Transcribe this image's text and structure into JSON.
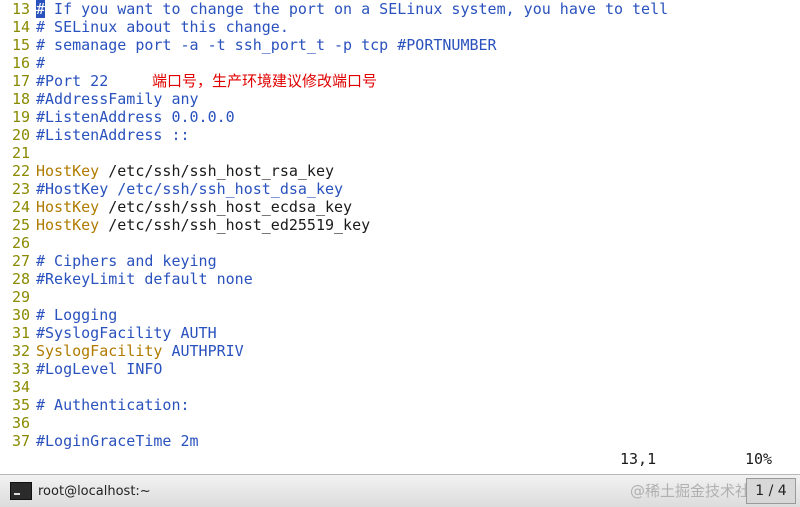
{
  "editor": {
    "lines": [
      {
        "n": "13",
        "tokens": [
          {
            "t": "#",
            "c": "cursor"
          },
          {
            "t": " If you want to change the port on a SELinux system, you have to tell",
            "c": "comment"
          }
        ]
      },
      {
        "n": "14",
        "tokens": [
          {
            "t": "# SELinux about this change.",
            "c": "comment"
          }
        ]
      },
      {
        "n": "15",
        "tokens": [
          {
            "t": "# semanage port -a -t ssh_port_t -p tcp #PORTNUMBER",
            "c": "comment"
          }
        ]
      },
      {
        "n": "16",
        "tokens": [
          {
            "t": "#",
            "c": "comment"
          }
        ]
      },
      {
        "n": "17",
        "tokens": [
          {
            "t": "#Port 22",
            "c": "comment"
          }
        ]
      },
      {
        "n": "18",
        "tokens": [
          {
            "t": "#AddressFamily any",
            "c": "comment"
          }
        ]
      },
      {
        "n": "19",
        "tokens": [
          {
            "t": "#ListenAddress 0.0.0.0",
            "c": "comment"
          }
        ]
      },
      {
        "n": "20",
        "tokens": [
          {
            "t": "#ListenAddress ::",
            "c": "comment"
          }
        ]
      },
      {
        "n": "21",
        "tokens": []
      },
      {
        "n": "22",
        "tokens": [
          {
            "t": "HostKey",
            "c": "kw"
          },
          {
            "t": " /etc/ssh/ssh_host_rsa_key",
            "c": "path"
          }
        ]
      },
      {
        "n": "23",
        "tokens": [
          {
            "t": "#HostKey /etc/ssh/ssh_host_dsa_key",
            "c": "comment"
          }
        ]
      },
      {
        "n": "24",
        "tokens": [
          {
            "t": "HostKey",
            "c": "kw"
          },
          {
            "t": " /etc/ssh/ssh_host_ecdsa_key",
            "c": "path"
          }
        ]
      },
      {
        "n": "25",
        "tokens": [
          {
            "t": "HostKey",
            "c": "kw"
          },
          {
            "t": " /etc/ssh/ssh_host_ed25519_key",
            "c": "path"
          }
        ]
      },
      {
        "n": "26",
        "tokens": []
      },
      {
        "n": "27",
        "tokens": [
          {
            "t": "# Ciphers and keying",
            "c": "comment"
          }
        ]
      },
      {
        "n": "28",
        "tokens": [
          {
            "t": "#RekeyLimit default none",
            "c": "comment"
          }
        ]
      },
      {
        "n": "29",
        "tokens": []
      },
      {
        "n": "30",
        "tokens": [
          {
            "t": "# Logging",
            "c": "comment"
          }
        ]
      },
      {
        "n": "31",
        "tokens": [
          {
            "t": "#SyslogFacility AUTH",
            "c": "comment"
          }
        ]
      },
      {
        "n": "32",
        "tokens": [
          {
            "t": "SyslogFacility",
            "c": "kw"
          },
          {
            "t": " AUTHPRIV",
            "c": "comment"
          }
        ]
      },
      {
        "n": "33",
        "tokens": [
          {
            "t": "#LogLevel INFO",
            "c": "comment"
          }
        ]
      },
      {
        "n": "34",
        "tokens": []
      },
      {
        "n": "35",
        "tokens": [
          {
            "t": "# Authentication:",
            "c": "comment"
          }
        ]
      },
      {
        "n": "36",
        "tokens": []
      },
      {
        "n": "37",
        "tokens": [
          {
            "t": "#LoginGraceTime 2m",
            "c": "comment"
          }
        ]
      }
    ],
    "annotation": "端口号，生产环境建议修改端口号"
  },
  "status": {
    "cursor_pos": "13,1",
    "percent": "10%"
  },
  "taskbar": {
    "task_label": "root@localhost:~",
    "watermark": "@稀土掘金技术社区",
    "pager": "1 / 4"
  },
  "colors": {
    "comment": "#2a52be",
    "keyword": "#b07b00",
    "line_number": "#8a8a00",
    "annotation": "#e00000"
  }
}
